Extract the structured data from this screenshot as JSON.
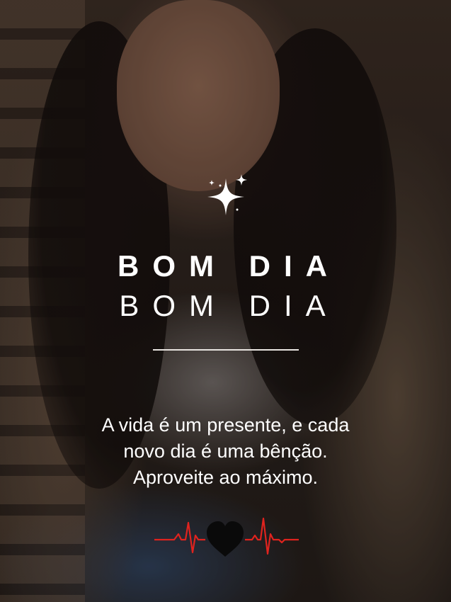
{
  "title": {
    "bold_line": "BOM DIA",
    "light_line": "BOM DIA"
  },
  "message": {
    "line1": "A vida é um presente, e cada",
    "line2": "novo dia é uma bênção.",
    "line3": "Aproveite ao máximo."
  },
  "icons": {
    "sparkle": "sparkle-icon",
    "heartbeat": "heartbeat-icon",
    "heart": "heart-icon"
  },
  "colors": {
    "text": "#ffffff",
    "divider": "#e8e4e0",
    "heartbeat_line": "#e0231e",
    "heart": "#0a0a0a"
  }
}
